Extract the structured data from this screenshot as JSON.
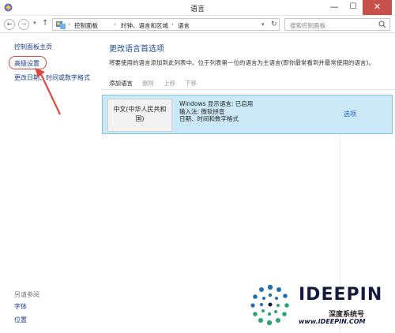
{
  "window": {
    "title": "语言",
    "minimize": "—",
    "maximize": "☐",
    "close": "✕"
  },
  "nav": {
    "back": "←",
    "forward": "→",
    "dropdown": "▾",
    "up": "↑",
    "breadcrumb": [
      "控制面板",
      "时钟、语言和区域",
      "语言"
    ],
    "separator": "›",
    "refresh": "↻",
    "search_placeholder": "搜索控制面板"
  },
  "sidebar": {
    "home": "控制面板主页",
    "advanced": "高级设置",
    "datetime": "更改日期、时间或数字格式",
    "see_also": "另请参阅",
    "font": "字体",
    "location": "位置"
  },
  "main": {
    "heading": "更改语言首选项",
    "description": "将要使用的语言添加到此列表中。位于列表第一位的语言为主语言(即你最常看到并最常使用的语言)。",
    "toolbar": {
      "add": "添加语言",
      "remove": "删除",
      "up": "上移",
      "down": "下移"
    },
    "language": {
      "name": "中文(中华人民共和国)",
      "display_line": "Windows 显示语言: 已启用",
      "input_line": "输入法: 微软拼音",
      "format_line": "日期、时间和数字格式",
      "options": "选项"
    }
  },
  "watermark": {
    "brand": "IDEEPIN",
    "subtitle": "深度系统号",
    "url": "www.IDEEPIN.COM"
  },
  "colors": {
    "accent": "#1f4a92",
    "link": "#1a3f8a",
    "selection": "#cbe8f6",
    "close_button": "#c7504b",
    "annotation": "#e0483f"
  }
}
